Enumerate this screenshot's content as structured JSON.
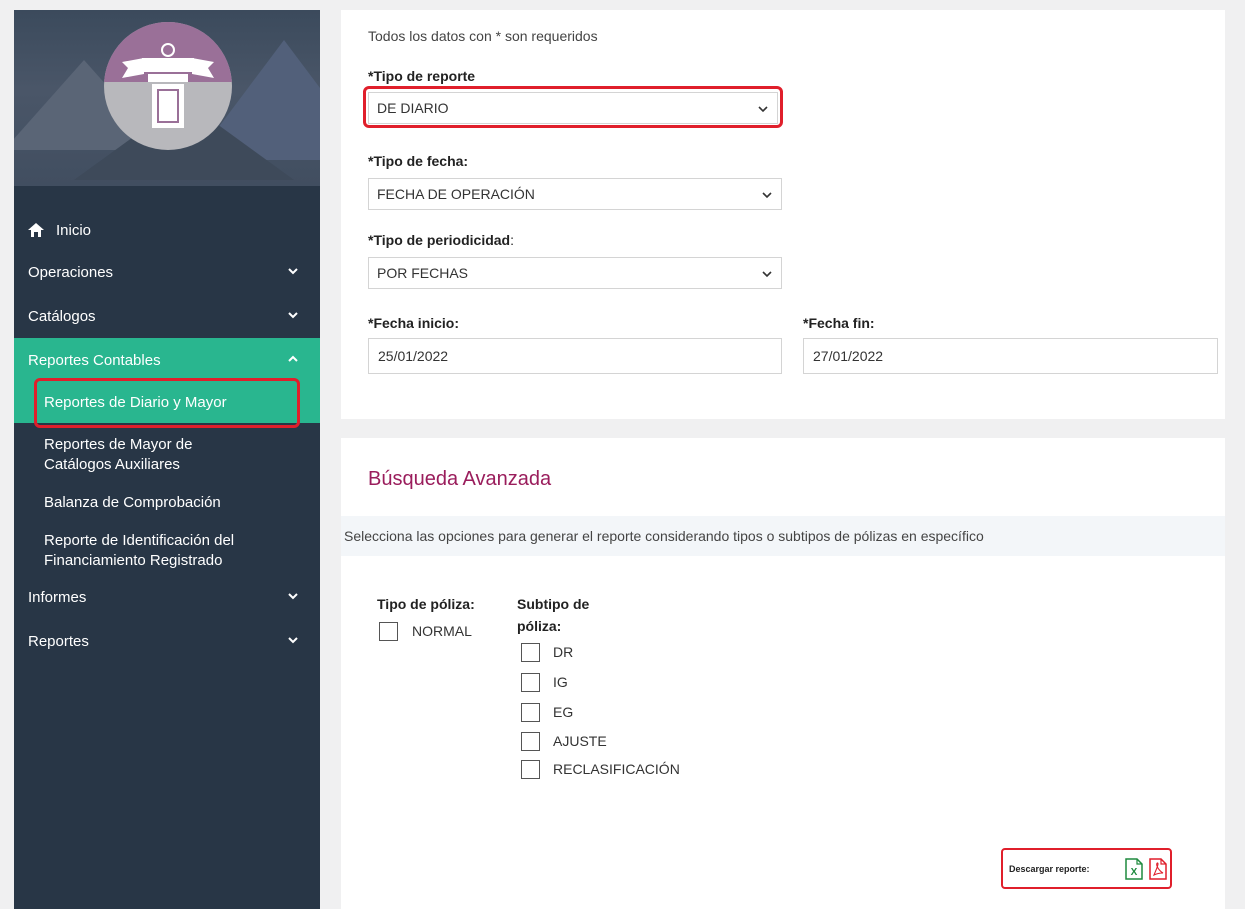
{
  "sidebar": {
    "items": [
      {
        "label": "Inicio",
        "icon": "home-icon"
      },
      {
        "label": "Operaciones",
        "icon": "chevron-down-icon"
      },
      {
        "label": "Catálogos",
        "icon": "chevron-down-icon"
      },
      {
        "label": "Reportes Contables",
        "icon": "chevron-up-icon"
      },
      {
        "label": "Informes",
        "icon": "chevron-down-icon"
      },
      {
        "label": "Reportes",
        "icon": "chevron-down-icon"
      }
    ],
    "subitems": [
      {
        "label": "Reportes de Diario y Mayor"
      },
      {
        "label_line1": "Reportes de Mayor de",
        "label_line2": "Catálogos Auxiliares"
      },
      {
        "label": "Balanza de Comprobación"
      },
      {
        "label_line1": "Reporte de Identificación del",
        "label_line2": "Financiamiento Registrado"
      }
    ]
  },
  "form": {
    "required_note": "Todos los datos con * son requeridos",
    "tipo_reporte": {
      "label": "*Tipo de reporte",
      "value": "DE DIARIO"
    },
    "tipo_fecha": {
      "label": "*Tipo de fecha:",
      "value": "FECHA DE OPERACIÓN"
    },
    "tipo_periodicidad": {
      "label": "*Tipo de periodicidad",
      "label_suffix": ":",
      "value": "POR FECHAS"
    },
    "fecha_inicio": {
      "label": "*Fecha inicio:",
      "value": "25/01/2022"
    },
    "fecha_fin": {
      "label": "*Fecha fin:",
      "value": "27/01/2022"
    }
  },
  "advanced": {
    "title": "Búsqueda Avanzada",
    "description": "Selecciona las opciones para generar el reporte considerando tipos o subtipos de pólizas en específico",
    "tipo_poliza_label": "Tipo de póliza:",
    "tipo_poliza_options": [
      "NORMAL"
    ],
    "subtipo_label_line1": "Subtipo de",
    "subtipo_label_line2": "póliza:",
    "subtipo_options": [
      "DR",
      "IG",
      "EG",
      "AJUSTE",
      "RECLASIFICACIÓN"
    ]
  },
  "download": {
    "label": "Descargar reporte:",
    "excel_glyph": "X",
    "icons": [
      "excel-file-icon",
      "pdf-file-icon"
    ]
  },
  "colors": {
    "sidebar_bg": "#283646",
    "active_green": "#29b68f",
    "highlight_red": "#e01f2b",
    "title_magenta": "#9a1d5c"
  }
}
